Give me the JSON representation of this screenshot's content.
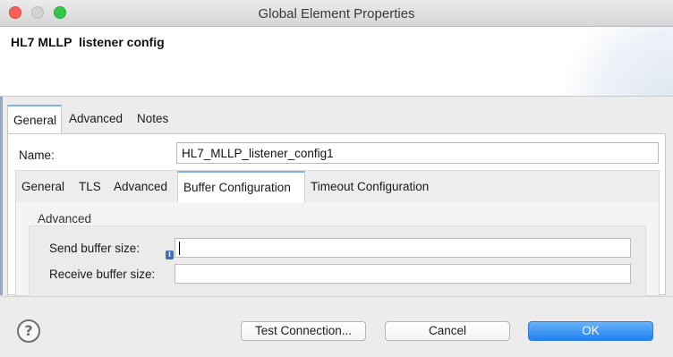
{
  "window": {
    "title": "Global Element Properties"
  },
  "header": {
    "title": "HL7 MLLP  listener config"
  },
  "outer_tabs": [
    {
      "label": "General",
      "active": true
    },
    {
      "label": "Advanced",
      "active": false
    },
    {
      "label": "Notes",
      "active": false
    }
  ],
  "name_field": {
    "label": "Name:",
    "value": "HL7_MLLP_listener_config1"
  },
  "inner_tabs": [
    {
      "label": "General",
      "active": false
    },
    {
      "label": "TLS",
      "active": false
    },
    {
      "label": "Advanced",
      "active": false
    },
    {
      "label": "Buffer Configuration",
      "active": true
    },
    {
      "label": "Timeout Configuration",
      "active": false
    }
  ],
  "advanced_group": {
    "title": "Advanced",
    "send_buffer": {
      "label": "Send buffer size:",
      "value": ""
    },
    "receive_buffer": {
      "label": "Receive buffer size:",
      "value": ""
    }
  },
  "buttons": {
    "test_connection": "Test Connection...",
    "cancel": "Cancel",
    "ok": "OK"
  },
  "icons": {
    "help": "help-icon",
    "info": "info-icon"
  },
  "colors": {
    "accent_tab": "#7fb2e5",
    "ok_button": "#1f83f0",
    "close_light": "#fc5f57",
    "zoom_light": "#33c748"
  }
}
